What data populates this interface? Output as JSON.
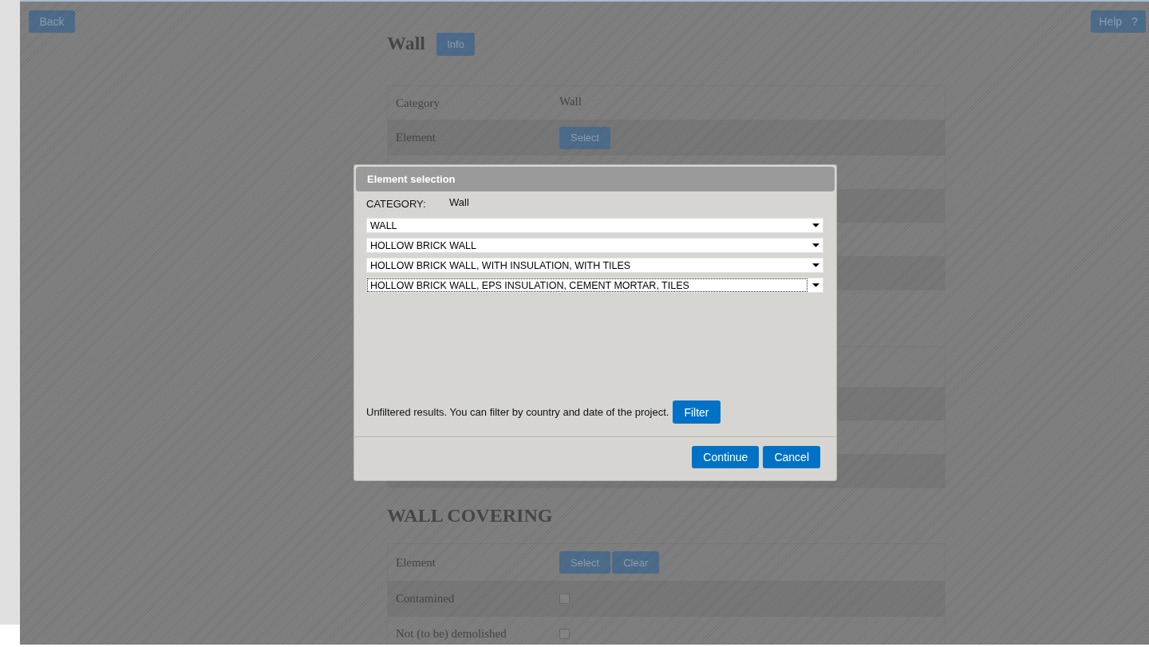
{
  "page": {
    "back_button": "Back",
    "help_button": "Help ?",
    "title": "Wall",
    "info_button": "Info",
    "element_table": {
      "rows": [
        {
          "label": "Category",
          "kind": "text",
          "value": "Wall"
        },
        {
          "label": "Element",
          "kind": "buttons",
          "buttons": [
            "Select"
          ]
        }
      ]
    },
    "wall_covering": {
      "heading": "WALL COVERING",
      "rows": [
        {
          "label": "Element",
          "kind": "buttons",
          "buttons": [
            "Select",
            "Clear"
          ]
        },
        {
          "label": "Contamined",
          "kind": "checkbox",
          "checked": false
        },
        {
          "label": "Not (to be) demolished",
          "kind": "checkbox",
          "checked": false
        }
      ]
    }
  },
  "dialog": {
    "title": "Element selection",
    "category_label": "CATEGORY:",
    "category_value": "Wall",
    "selects": [
      {
        "value": "WALL",
        "focused": false
      },
      {
        "value": "HOLLOW BRICK WALL",
        "focused": false
      },
      {
        "value": "HOLLOW BRICK WALL, WITH INSULATION, WITH TILES",
        "focused": false
      },
      {
        "value": "HOLLOW BRICK WALL, EPS INSULATION, CEMENT MORTAR, TILES",
        "focused": true
      }
    ],
    "filter_note": "Unfiltered results. You can filter by country and date of the project.",
    "filter_button": "Filter",
    "buttons": [
      "Continue",
      "Cancel"
    ]
  }
}
